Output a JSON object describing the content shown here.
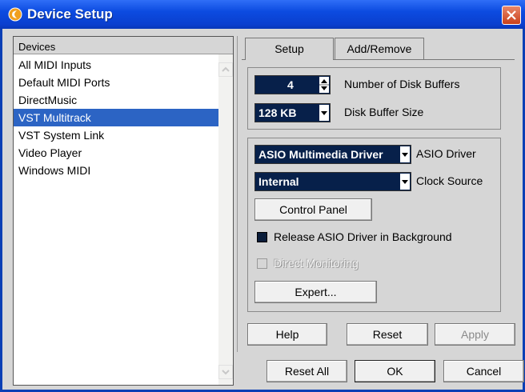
{
  "window": {
    "title": "Device Setup"
  },
  "left_panel": {
    "header": "Devices",
    "items": [
      {
        "label": "All MIDI Inputs",
        "selected": false
      },
      {
        "label": "Default MIDI Ports",
        "selected": false
      },
      {
        "label": "DirectMusic",
        "selected": false
      },
      {
        "label": "VST Multitrack",
        "selected": true
      },
      {
        "label": "VST System Link",
        "selected": false
      },
      {
        "label": "Video Player",
        "selected": false
      },
      {
        "label": "Windows MIDI",
        "selected": false
      }
    ]
  },
  "tabs": [
    {
      "label": "Setup",
      "active": true
    },
    {
      "label": "Add/Remove",
      "active": false
    }
  ],
  "disk": {
    "buffers_value": "4",
    "buffers_label": "Number of Disk Buffers",
    "buffer_size_value": "128 KB",
    "buffer_size_label": "Disk Buffer Size"
  },
  "asio": {
    "driver_value": "ASIO Multimedia Driver",
    "driver_label": "ASIO Driver",
    "clock_value": "Internal",
    "clock_label": "Clock Source",
    "control_panel_label": "Control Panel",
    "release_label": "Release ASIO Driver in Background",
    "release_checked": true,
    "direct_monitoring_label": "Direct Monitoring",
    "direct_monitoring_enabled": false,
    "expert_label": "Expert..."
  },
  "panel_buttons": {
    "help": "Help",
    "reset": "Reset",
    "apply": "Apply"
  },
  "dialog_buttons": {
    "reset_all": "Reset All",
    "ok": "OK",
    "cancel": "Cancel"
  },
  "colors": {
    "titlebar": "#0c4be0",
    "selection": "#2c64c4",
    "field_bg": "#07204a",
    "dialog_bg": "#d6d6d6"
  }
}
